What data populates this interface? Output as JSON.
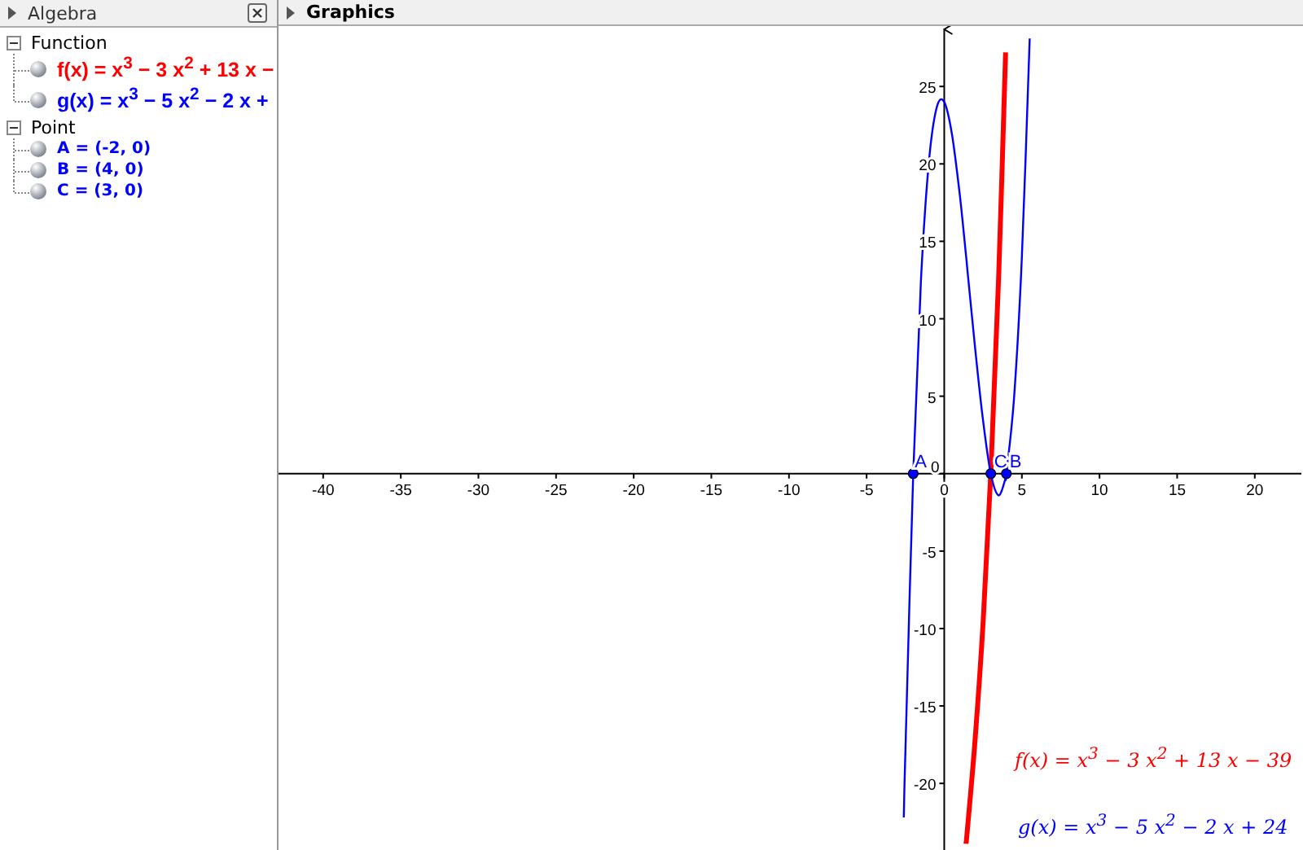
{
  "algebra": {
    "title": "Algebra",
    "groups": [
      {
        "label": "Function",
        "expanded": true,
        "items": [
          {
            "text": "f(x) = x$^{3}$ − 3 x$^{2}$ + 13 x −",
            "color": "#ff0000"
          },
          {
            "text": "g(x) = x$^{3}$ − 5 x$^{2}$ − 2 x +",
            "color": "#0000ff"
          }
        ]
      },
      {
        "label": "Point",
        "expanded": true,
        "items": [
          {
            "text": "A = (-2, 0)",
            "color": "#0000ff"
          },
          {
            "text": "B = (4, 0)",
            "color": "#0000ff"
          },
          {
            "text": "C = (3, 0)",
            "color": "#0000ff"
          }
        ]
      }
    ]
  },
  "graphics": {
    "title": "Graphics",
    "chart_data": {
      "type": "line",
      "x": [
        -2.6,
        -2.5,
        -2,
        -1.5,
        -1,
        -0.5,
        0,
        0.5,
        1,
        1.4,
        1.5,
        2,
        2.5,
        3,
        3.5,
        3.95,
        4,
        4.5,
        5,
        5.5
      ],
      "series": [
        {
          "name": "f(x) = x$^{3}$ − 3 x$^{2}$ + 13 x − 39",
          "color": "#ff0000",
          "values": [
            null,
            null,
            null,
            null,
            null,
            null,
            null,
            null,
            null,
            -23.9,
            -22.9,
            -17,
            -9.6,
            0,
            12.6,
            27.2,
            null,
            null,
            null,
            null
          ]
        },
        {
          "name": "g(x) = x$^{3}$ − 5 x$^{2}$ − 2 x + 24",
          "color": "#0000ff",
          "values": [
            -22.2,
            -17.9,
            0,
            12.4,
            20,
            23.6,
            24,
            21.9,
            18,
            14.1,
            13.1,
            8,
            3.4,
            0,
            -1.4,
            -0.3,
            0,
            4.9,
            14,
            28.1
          ]
        }
      ],
      "xlim": [
        -42.875,
        23
      ],
      "ylim": [
        -24.3,
        28.9
      ],
      "xticks": [
        -40,
        -35,
        -30,
        -25,
        -20,
        -15,
        -10,
        -5,
        0,
        5,
        10,
        15,
        20
      ],
      "yticks": [
        -20,
        -15,
        -10,
        -5,
        0,
        5,
        10,
        15,
        20,
        25
      ],
      "annotations": [
        {
          "text": "A",
          "x": -2,
          "y": 0
        },
        {
          "text": "C",
          "x": 3,
          "y": 0
        },
        {
          "text": "B",
          "x": 4,
          "y": 0
        }
      ]
    }
  }
}
